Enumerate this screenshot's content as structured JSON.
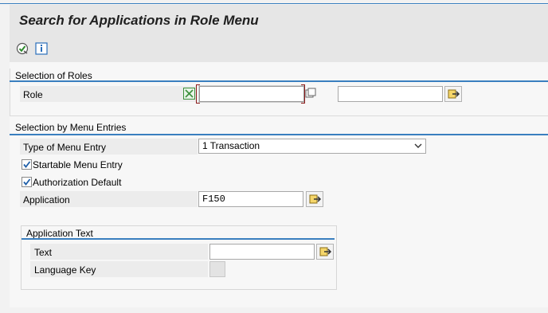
{
  "window": {
    "title": "Search for Applications in Role Menu"
  },
  "toolbar": {
    "execute_icon": "execute-icon",
    "info_icon": "info-icon"
  },
  "roles_section": {
    "title": "Selection of Roles",
    "role_label": "Role",
    "role_from_value": "",
    "role_to_value": ""
  },
  "menu_section": {
    "title": "Selection by Menu Entries",
    "type_label": "Type of Menu Entry",
    "type_value": "1 Transaction",
    "startable_label": "Startable Menu Entry",
    "startable_checked": true,
    "auth_label": "Authorization Default",
    "auth_checked": true,
    "application_label": "Application",
    "application_value": "F150",
    "app_text_group": {
      "title": "Application Text",
      "text_label": "Text",
      "text_value": "",
      "language_label": "Language Key",
      "language_value": ""
    }
  },
  "colors": {
    "accent": "#3a7fbf",
    "title_bg": "#e6e6e6",
    "content_bg": "#f7f7f7"
  }
}
